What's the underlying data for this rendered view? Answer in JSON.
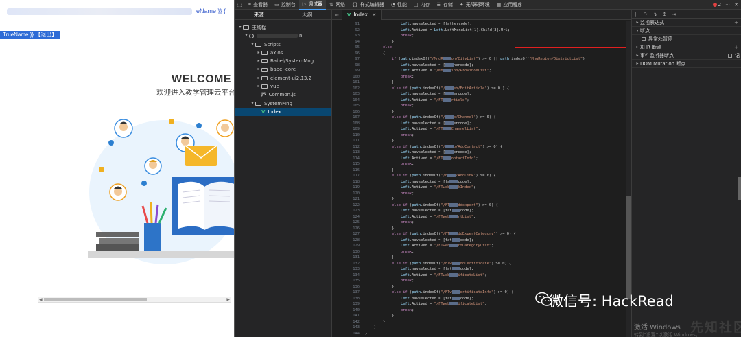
{
  "webpage": {
    "top_name": "eName }} {",
    "selection_bar": "TrueName }} 【退出】",
    "welcome_title": "WELCOME",
    "welcome_subtitle": "欢迎进入教学管理云平台",
    "scroll_left": "◀",
    "scroll_right": "▶"
  },
  "devtools": {
    "toolbar": [
      {
        "icon": "inspector-icon",
        "glyph": "⧈",
        "label": "查看器",
        "active": false
      },
      {
        "icon": "console-icon",
        "glyph": "▭",
        "label": "控制台",
        "active": false
      },
      {
        "icon": "debugger-icon",
        "glyph": "▷",
        "label": "调试器",
        "active": true
      },
      {
        "icon": "network-icon",
        "glyph": "⇅",
        "label": "网络",
        "active": false
      },
      {
        "icon": "style-editor-icon",
        "glyph": "{}",
        "label": "样式编辑器",
        "active": false
      },
      {
        "icon": "performance-icon",
        "glyph": "◔",
        "label": "性能",
        "active": false
      },
      {
        "icon": "memory-icon",
        "glyph": "◫",
        "label": "内存",
        "active": false
      },
      {
        "icon": "storage-icon",
        "glyph": "☰",
        "label": "存储",
        "active": false
      },
      {
        "icon": "accessibility-icon",
        "glyph": "✦",
        "label": "无障碍环境",
        "active": false
      },
      {
        "icon": "application-icon",
        "glyph": "▦",
        "label": "应用程序",
        "active": false
      }
    ],
    "error_count": "2",
    "sources_tabs": [
      "来源",
      "大纲"
    ],
    "tree": [
      {
        "level": 0,
        "arrow": "▾",
        "kind": "folder",
        "label": "主线程"
      },
      {
        "level": 1,
        "arrow": "▾",
        "kind": "globe",
        "label": "n"
      },
      {
        "level": 2,
        "arrow": "▾",
        "kind": "folder",
        "label": "Scripts"
      },
      {
        "level": 3,
        "arrow": "▸",
        "kind": "folder",
        "label": "axios"
      },
      {
        "level": 3,
        "arrow": "▸",
        "kind": "folder",
        "label": "Babel/SystemMng"
      },
      {
        "level": 3,
        "arrow": "▸",
        "kind": "folder",
        "label": "babel-core"
      },
      {
        "level": 3,
        "arrow": "▸",
        "kind": "folder",
        "label": "element-ui2.13.2"
      },
      {
        "level": 3,
        "arrow": "▸",
        "kind": "folder",
        "label": "vue"
      },
      {
        "level": 3,
        "arrow": "",
        "kind": "js",
        "label": "Common.js"
      },
      {
        "level": 2,
        "arrow": "▾",
        "kind": "folder",
        "label": "SystemMng"
      },
      {
        "level": 3,
        "arrow": "",
        "kind": "vue",
        "label": "Index",
        "selected": true
      }
    ],
    "editor_tab": "Index",
    "right_toolbar": [
      "||",
      "↷",
      "↴",
      "↥",
      "⇥"
    ],
    "right_sections": [
      {
        "label": "监视表达式",
        "plus": "+",
        "expanded": false
      },
      {
        "label": "断点",
        "expanded": true
      },
      {
        "label": "异常处暂停",
        "checkbox": true
      },
      {
        "label": "XHR 断点",
        "plus": "+",
        "expanded": false
      },
      {
        "label": "事件监听器断点",
        "checkbox_right": "记",
        "expanded": false
      },
      {
        "label": "DOM Mutation 断点",
        "expanded": false
      }
    ],
    "watermark": "微信号: HackRead",
    "activate_title": "激活 Windows",
    "activate_sub": "转到“设置”以激活 Windows。",
    "site_mark": "先知社区"
  },
  "code": {
    "lines": [
      {
        "n": "91",
        "t": "                Left.navselected = [fathercode];"
      },
      {
        "n": "92",
        "t": "                Left.Actived = Left.LeftMenuList[1].Child[3].Url;"
      },
      {
        "n": "93",
        "t": "                break;"
      },
      {
        "n": "94",
        "t": "            }"
      },
      {
        "n": "95",
        "t": "        else"
      },
      {
        "n": "96",
        "t": "        {"
      },
      {
        "n": "97",
        "t": "            if (path.indexOf(\"/MngR     on/CityList\") >= 0 || path.indexOf(\"MngRegion/DistrictList\")"
      },
      {
        "n": "98",
        "t": "                Left.navselected = [     hercode];"
      },
      {
        "n": "99",
        "t": "                Left.Actived = \"/Mn     ion/ProvinceList\";"
      },
      {
        "n": "100",
        "t": "                break;"
      },
      {
        "n": "101",
        "t": "            }"
      },
      {
        "n": "102",
        "t": "            else if (path.indexOf(\"/     eb/EditArticle\") >= 0 ) {"
      },
      {
        "n": "103",
        "t": "                Left.navselected = [     ercode];"
      },
      {
        "n": "104",
        "t": "                Left.Actived = \"/FT     rticle\";"
      },
      {
        "n": "105",
        "t": "                break;"
      },
      {
        "n": "106",
        "t": "            }"
      },
      {
        "n": "107",
        "t": "            else if (path.indexOf(\"/     b/Channel\") >= 0) {"
      },
      {
        "n": "108",
        "t": "                Left.navselected = [     ercode];"
      },
      {
        "n": "109",
        "t": "                Left.Actived = \"/FT     ChannelList\";"
      },
      {
        "n": "110",
        "t": "                break;"
      },
      {
        "n": "111",
        "t": "            }"
      },
      {
        "n": "112",
        "t": "            else if (path.indexOf(\"/     b/AddContact\") >= 0) {"
      },
      {
        "n": "113",
        "t": "                Left.navselected = [     ercode];"
      },
      {
        "n": "114",
        "t": "                Left.Actived = \"/FT     ontactInfo\";"
      },
      {
        "n": "115",
        "t": "                break;"
      },
      {
        "n": "116",
        "t": "            }"
      },
      {
        "n": "117",
        "t": "            else if (path.indexOf(\"/F     /AddLink\") >= 0) {"
      },
      {
        "n": "118",
        "t": "                Left.navselected = [fa     code];"
      },
      {
        "n": "119",
        "t": "                Left.Actived = \"/FTweb     kIndex\";"
      },
      {
        "n": "120",
        "t": "                break;"
      },
      {
        "n": "121",
        "t": "            }"
      },
      {
        "n": "122",
        "t": "            else if (path.indexOf(\"/FT     ddexpert\") >= 0) {"
      },
      {
        "n": "123",
        "t": "                Left.navselected = [fat     code];"
      },
      {
        "n": "124",
        "t": "                Left.Actived = \"/FTweb     rtList\";"
      },
      {
        "n": "125",
        "t": "                break;"
      },
      {
        "n": "126",
        "t": "            }"
      },
      {
        "n": "127",
        "t": "            else if (path.indexOf(\"/FT     ddExpertCategory\") >= 0) {"
      },
      {
        "n": "128",
        "t": "                Left.navselected = [fat     code];"
      },
      {
        "n": "129",
        "t": "                Left.Actived = \"/FTweb     rtCategoryList\";"
      },
      {
        "n": "130",
        "t": "                break;"
      },
      {
        "n": "131",
        "t": "            }"
      },
      {
        "n": "132",
        "t": "            else if (path.indexOf(\"/FTw     ddCertificate\") >= 0) {"
      },
      {
        "n": "133",
        "t": "                Left.navselected = [fat     code];"
      },
      {
        "n": "134",
        "t": "                Left.Actived = \"/FTweb     ificateList\";"
      },
      {
        "n": "135",
        "t": "                break;"
      },
      {
        "n": "136",
        "t": "            }"
      },
      {
        "n": "137",
        "t": "            else if (path.indexOf(\"/FTw     ertificateInfo\") >= 0) {"
      },
      {
        "n": "138",
        "t": "                Left.navselected = [fat     code];"
      },
      {
        "n": "139",
        "t": "                Left.Actived = \"/FTweb     ificateList\";"
      },
      {
        "n": "140",
        "t": "                break;"
      },
      {
        "n": "141",
        "t": "            }"
      },
      {
        "n": "142",
        "t": "        }"
      },
      {
        "n": "143",
        "t": "    }"
      },
      {
        "n": "144",
        "t": "}"
      }
    ]
  },
  "colors": {
    "accent": "#4aa3ff",
    "selection": "#094771",
    "highlight_box": "#e02020"
  }
}
